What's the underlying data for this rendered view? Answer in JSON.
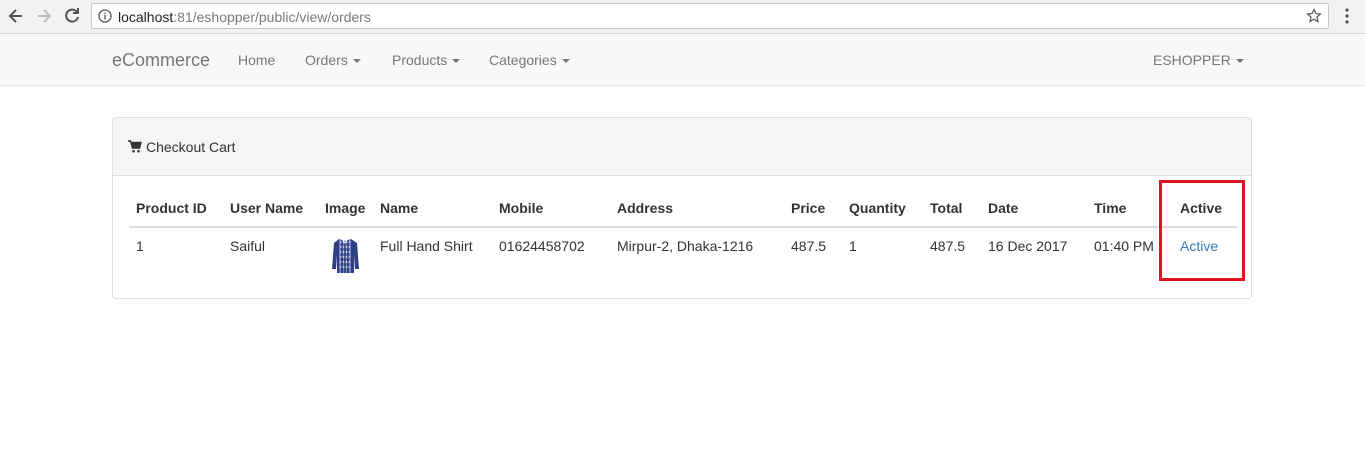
{
  "browser": {
    "url_host": "localhost",
    "url_rest": ":81/eshopper/public/view/orders"
  },
  "navbar": {
    "brand": "eCommerce",
    "items": [
      "Home",
      "Orders",
      "Products",
      "Categories"
    ],
    "user_menu": "ESHOPPER"
  },
  "panel": {
    "title": "Checkout Cart"
  },
  "table": {
    "headers": [
      "Product ID",
      "User Name",
      "Image",
      "Name",
      "Mobile",
      "Address",
      "Price",
      "Quantity",
      "Total",
      "Date",
      "Time",
      "Active"
    ],
    "rows": [
      {
        "product_id": "1",
        "user_name": "Saiful",
        "image": "shirt-thumbnail",
        "name": "Full Hand Shirt",
        "mobile": "01624458702",
        "address": "Mirpur-2, Dhaka-1216",
        "price": "487.5",
        "quantity": "1",
        "total": "487.5",
        "date": "16 Dec 2017",
        "time": "01:40 PM",
        "active": "Active"
      }
    ]
  },
  "colors": {
    "link": "#337ab7",
    "highlight": "#e0141f"
  },
  "icons": [
    "back-arrow-icon",
    "forward-arrow-icon",
    "reload-icon",
    "info-icon",
    "star-icon",
    "menu-icon",
    "cart-icon"
  ]
}
